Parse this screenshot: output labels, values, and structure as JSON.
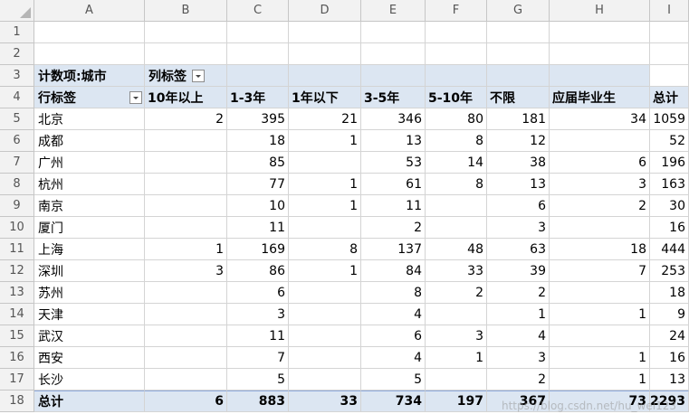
{
  "columns": [
    "A",
    "B",
    "C",
    "D",
    "E",
    "F",
    "G",
    "H",
    "I"
  ],
  "row_numbers": [
    "1",
    "2",
    "3",
    "4",
    "5",
    "6",
    "7",
    "8",
    "9",
    "10",
    "11",
    "12",
    "13",
    "14",
    "15",
    "16",
    "17",
    "18"
  ],
  "pivot": {
    "value_field_label": "计数项:城市",
    "column_labels_caption": "列标签",
    "row_labels_caption": "行标签",
    "column_headers": [
      "10年以上",
      "1-3年",
      "1年以下",
      "3-5年",
      "5-10年",
      "不限",
      "应届毕业生",
      "总计"
    ],
    "rows": [
      {
        "city": "北京",
        "values": [
          "2",
          "395",
          "21",
          "346",
          "80",
          "181",
          "34",
          "1059"
        ]
      },
      {
        "city": "成都",
        "values": [
          "",
          "18",
          "1",
          "13",
          "8",
          "12",
          "",
          "52"
        ]
      },
      {
        "city": "广州",
        "values": [
          "",
          "85",
          "",
          "53",
          "14",
          "38",
          "6",
          "196"
        ]
      },
      {
        "city": "杭州",
        "values": [
          "",
          "77",
          "1",
          "61",
          "8",
          "13",
          "3",
          "163"
        ]
      },
      {
        "city": "南京",
        "values": [
          "",
          "10",
          "1",
          "11",
          "",
          "6",
          "2",
          "30"
        ]
      },
      {
        "city": "厦门",
        "values": [
          "",
          "11",
          "",
          "2",
          "",
          "3",
          "",
          "16"
        ]
      },
      {
        "city": "上海",
        "values": [
          "1",
          "169",
          "8",
          "137",
          "48",
          "63",
          "18",
          "444"
        ]
      },
      {
        "city": "深圳",
        "values": [
          "3",
          "86",
          "1",
          "84",
          "33",
          "39",
          "7",
          "253"
        ]
      },
      {
        "city": "苏州",
        "values": [
          "",
          "6",
          "",
          "8",
          "2",
          "2",
          "",
          "18"
        ]
      },
      {
        "city": "天津",
        "values": [
          "",
          "3",
          "",
          "4",
          "",
          "1",
          "1",
          "9"
        ]
      },
      {
        "city": "武汉",
        "values": [
          "",
          "11",
          "",
          "6",
          "3",
          "4",
          "",
          "24"
        ]
      },
      {
        "city": "西安",
        "values": [
          "",
          "7",
          "",
          "4",
          "1",
          "3",
          "1",
          "16"
        ]
      },
      {
        "city": "长沙",
        "values": [
          "",
          "5",
          "",
          "5",
          "",
          "2",
          "1",
          "13"
        ]
      }
    ],
    "total_label": "总计",
    "totals": [
      "6",
      "883",
      "33",
      "734",
      "197",
      "367",
      "73",
      "2293"
    ]
  },
  "watermark": "https://blog.csdn.net/hu_wei123"
}
